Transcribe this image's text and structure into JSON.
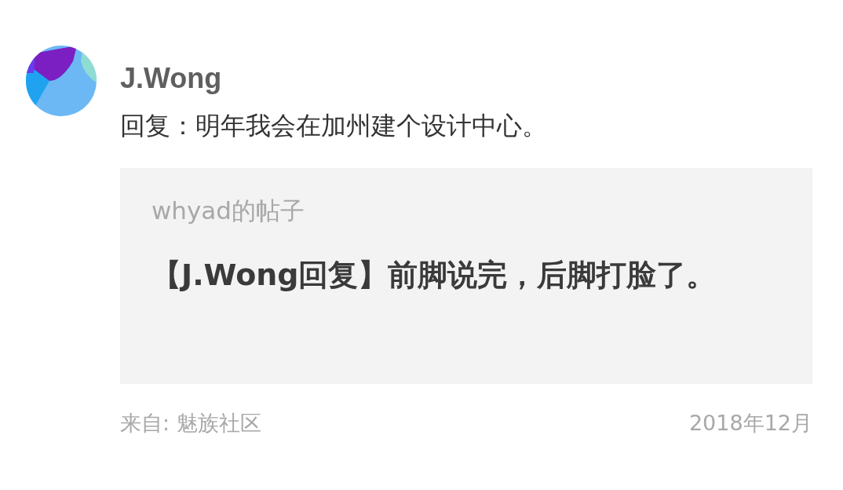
{
  "comment": {
    "author": "J.Wong",
    "text": "回复：明年我会在加州建个设计中心。"
  },
  "quote": {
    "source": "whyad的帖子",
    "text": "【J.Wong回复】前脚说完，后脚打脸了。"
  },
  "footer": {
    "origin": "来自: 魅族社区",
    "date": "2018年12月"
  }
}
